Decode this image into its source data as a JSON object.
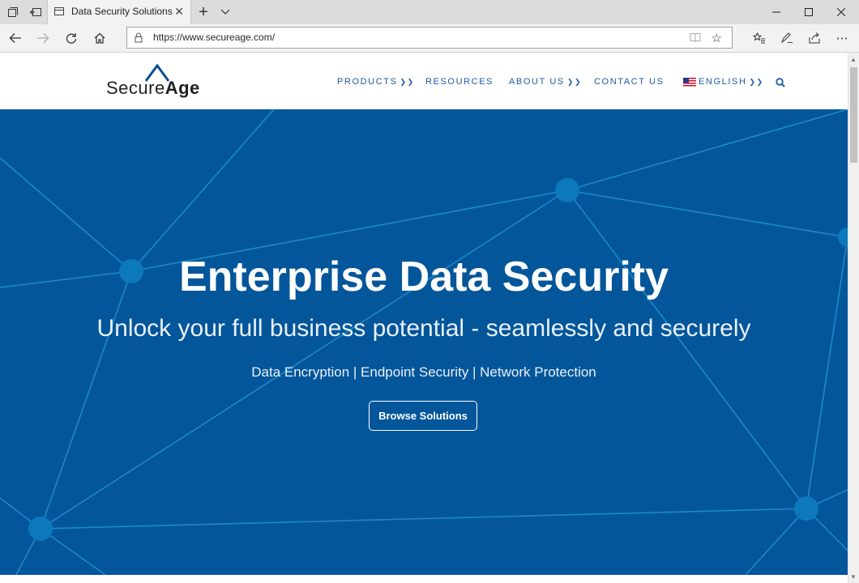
{
  "browser": {
    "tab_title": "Data Security Solutions",
    "url": "https://www.secureage.com/"
  },
  "site": {
    "logo": {
      "prefix": "Secure",
      "suffix": "Age"
    },
    "nav": {
      "products": "PRODUCTS",
      "resources": "RESOURCES",
      "about": "ABOUT US",
      "contact": "CONTACT US",
      "language": "ENGLISH"
    }
  },
  "hero": {
    "title": "Enterprise Data Security",
    "subtitle": "Unlock your full business potential - seamlessly and securely",
    "tagline": "Data Encryption | Endpoint Security | Network Protection",
    "cta": "Browse Solutions"
  },
  "colors": {
    "hero_bg": "#04569a",
    "network": "#1a8ac8",
    "nav_text": "#1f5aa6"
  }
}
